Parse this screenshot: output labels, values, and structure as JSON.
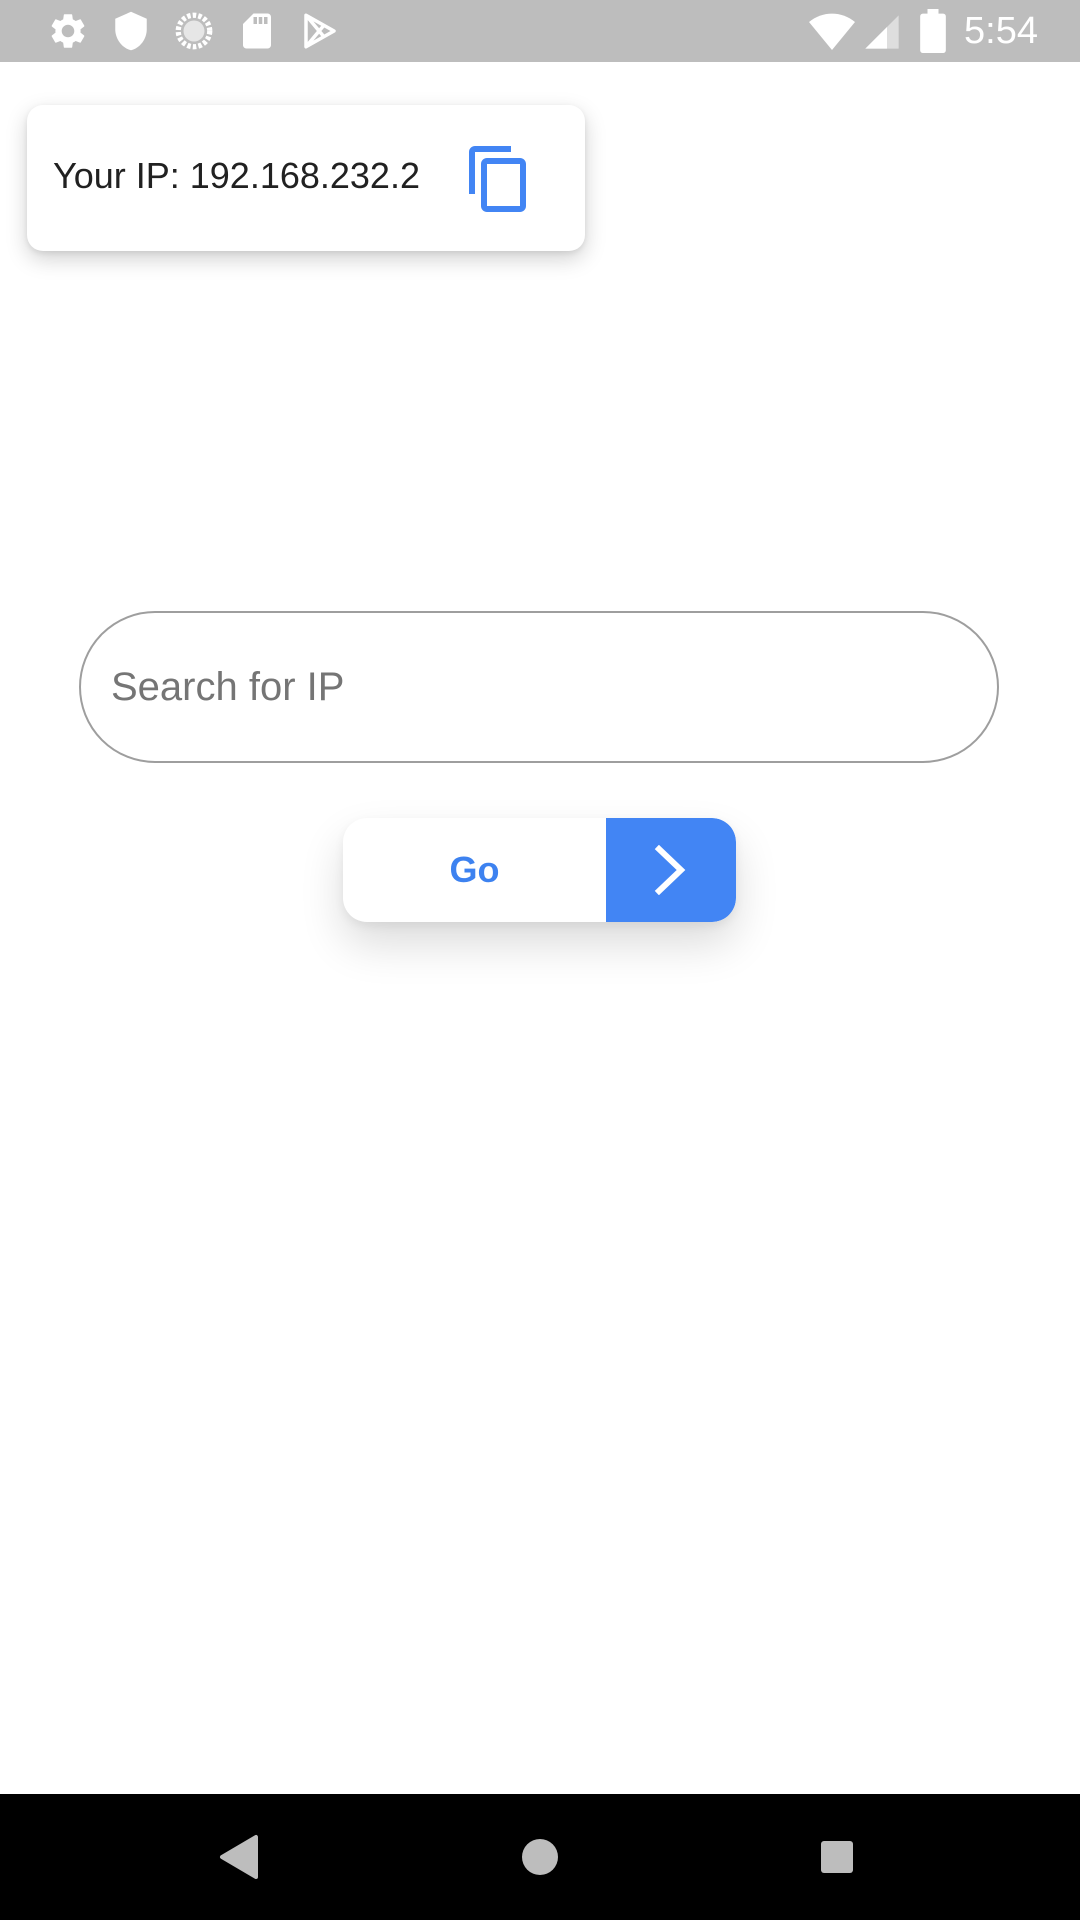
{
  "status_bar": {
    "time": "5:54",
    "left_icons": [
      "gear-icon",
      "shield-icon",
      "sync-icon",
      "sd-card-icon",
      "play-store-icon"
    ],
    "right_icons": [
      "wifi-icon",
      "cell-signal-icon",
      "battery-icon"
    ],
    "background": "#bdbdbd"
  },
  "ip_card": {
    "text": "Your IP: 192.168.232.2",
    "copy_icon": "copy-icon"
  },
  "search": {
    "placeholder": "Search for IP",
    "value": ""
  },
  "go_button": {
    "label": "Go",
    "icon": "chevron-right-icon"
  },
  "nav_bar": {
    "buttons": [
      "back-icon",
      "home-icon",
      "recents-icon"
    ]
  },
  "colors": {
    "accent": "#4285f4",
    "text": "#212121",
    "placeholder": "#757575"
  }
}
